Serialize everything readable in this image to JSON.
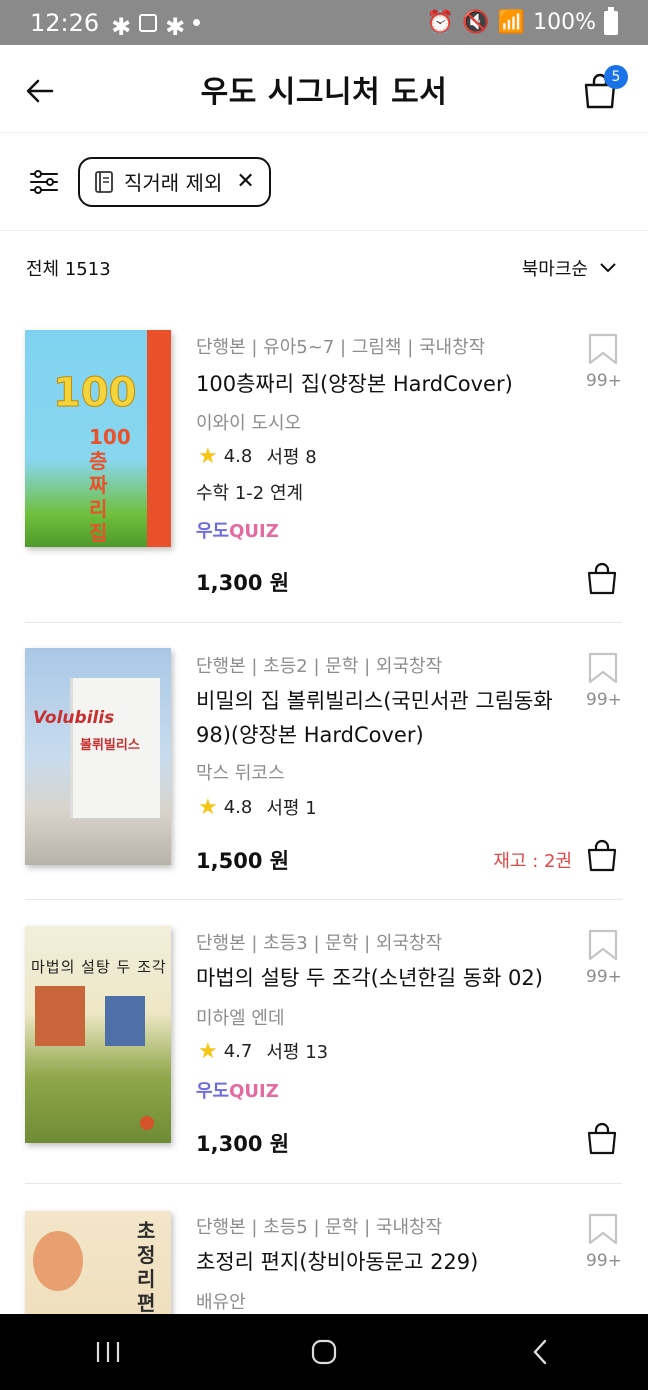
{
  "status_bar": {
    "time": "12:26",
    "battery": "100%"
  },
  "header": {
    "title": "우도 시그니처 도서",
    "cart_count": "5"
  },
  "filter": {
    "chip_label": "직거래 제외"
  },
  "list": {
    "total_label": "전체 1513",
    "sort_label": "북마크순"
  },
  "books": [
    {
      "meta": "단행본 | 유아5~7 | 그림책 | 국내창작",
      "title": "100층짜리 집(양장본 HardCover)",
      "author": "이와이 도시오",
      "rating": "4.8",
      "reviews": "서평 8",
      "subject_link": "수학 1-2 연계",
      "quiz_part1": "우도",
      "quiz_part2": "QUIZ",
      "price": "1,300 원",
      "bookmark_count": "99+",
      "cover_text": "100층짜리 집"
    },
    {
      "meta": "단행본 | 초등2 | 문학 | 외국창작",
      "title": "비밀의 집 볼뤼빌리스(국민서관 그림동화 98)(양장본 HardCover)",
      "author": "막스 뒤코스",
      "rating": "4.8",
      "reviews": "서평 1",
      "price": "1,500 원",
      "stock": "재고 : 2권",
      "bookmark_count": "99+",
      "cover_text_en": "Volubilis",
      "cover_text_ko": "볼뤼빌리스"
    },
    {
      "meta": "단행본 | 초등3 | 문학 | 외국창작",
      "title": "마법의 설탕 두 조각(소년한길 동화 02)",
      "author": "미하엘 엔데",
      "rating": "4.7",
      "reviews": "서평 13",
      "quiz_part1": "우도",
      "quiz_part2": "QUIZ",
      "price": "1,300 원",
      "bookmark_count": "99+",
      "cover_text": "마법의 설탕 두 조각"
    },
    {
      "meta": "단행본 | 초등5 | 문학 | 국내창작",
      "title": "초정리 편지(창비아동문고 229)",
      "author": "배유안",
      "bookmark_count": "99+",
      "cover_text": "초정리 편지"
    }
  ],
  "colors": {
    "accent_blue": "#1a73e8",
    "quiz_purple": "#6d6de0",
    "quiz_pink": "#e46aa1",
    "stock_red": "#e04848",
    "star": "#f5c518"
  }
}
